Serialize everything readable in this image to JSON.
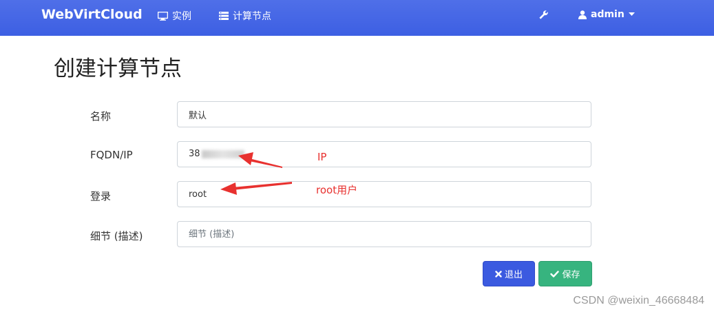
{
  "navbar": {
    "brand": "WebVirtCloud",
    "instances_label": "实例",
    "compute_label": "计算节点",
    "user_label": "admin",
    "icons": [
      "monitor-icon",
      "server-list-icon",
      "wrench-icon",
      "user-icon",
      "caret-down-icon"
    ]
  },
  "page": {
    "title": "创建计算节点"
  },
  "form": {
    "name_label": "名称",
    "name_value": "默认",
    "fqdn_label": "FQDN/IP",
    "fqdn_value": "38",
    "login_label": "登录",
    "login_value": "root",
    "details_label": "细节 (描述)",
    "details_placeholder": "细节 (描述)"
  },
  "buttons": {
    "cancel_label": "退出",
    "save_label": "保存"
  },
  "annotations": {
    "ip_note": "IP",
    "root_note": "root用户",
    "color": "#e8312f"
  },
  "watermark": "CSDN @weixin_46668484",
  "colors": {
    "navbar": "#4466e6",
    "cancel": "#3b5ae0",
    "save": "#37b47f"
  }
}
